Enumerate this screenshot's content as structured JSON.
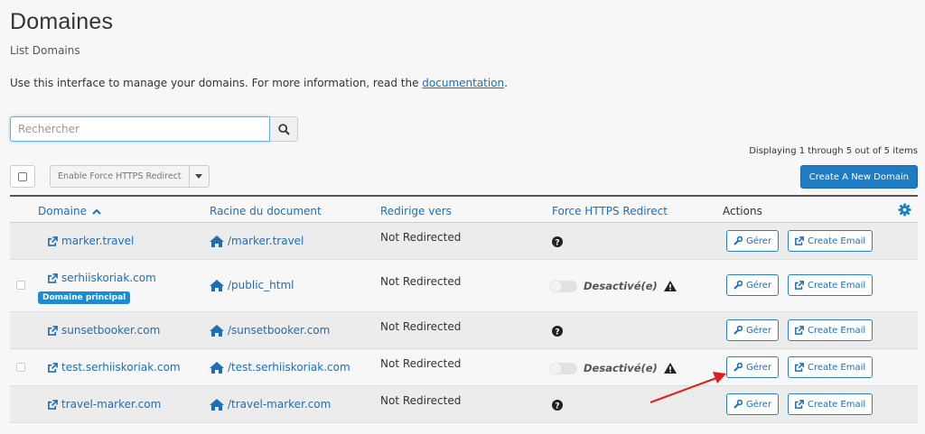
{
  "page": {
    "title": "Domaines",
    "subtitle": "List Domains",
    "intro_text": "Use this interface to manage your domains. For more information, read the ",
    "intro_link": "documentation",
    "intro_end": "."
  },
  "search": {
    "placeholder": "Rechercher",
    "value": ""
  },
  "toolbar": {
    "displaying": "Displaying 1 through 5 out of 5 items",
    "enable_https_label": "Enable Force HTTPS Redirect",
    "create_label": "Create A New Domain"
  },
  "table": {
    "headers": {
      "domain": "Domaine",
      "docroot": "Racine du document",
      "redirect": "Redirige vers",
      "https": "Force HTTPS Redirect",
      "actions": "Actions"
    },
    "rows": [
      {
        "domain": "marker.travel",
        "docroot": "/marker.travel",
        "redirect": "Not Redirected",
        "badge": "",
        "https_state": "",
        "manage": "Gérer",
        "email": "Create Email"
      },
      {
        "domain": "serhiiskoriak.com",
        "docroot": "/public_html",
        "redirect": "Not Redirected",
        "badge": "Domaine principal",
        "https_state": "Desactivé(e)",
        "manage": "Gérer",
        "email": "Create Email"
      },
      {
        "domain": "sunsetbooker.com",
        "docroot": "/sunsetbooker.com",
        "redirect": "Not Redirected",
        "badge": "",
        "https_state": "",
        "manage": "Gérer",
        "email": "Create Email"
      },
      {
        "domain": "test.serhiiskoriak.com",
        "docroot": "/test.serhiiskoriak.com",
        "redirect": "Not Redirected",
        "badge": "",
        "https_state": "Desactivé(e)",
        "manage": "Gérer",
        "email": "Create Email"
      },
      {
        "domain": "travel-marker.com",
        "docroot": "/travel-marker.com",
        "redirect": "Not Redirected",
        "badge": "",
        "https_state": "",
        "manage": "Gérer",
        "email": "Create Email"
      }
    ]
  },
  "colors": {
    "accent": "#1d7cc4",
    "link": "#1d6fb5",
    "annotation_arrow": "#e41b1b"
  }
}
